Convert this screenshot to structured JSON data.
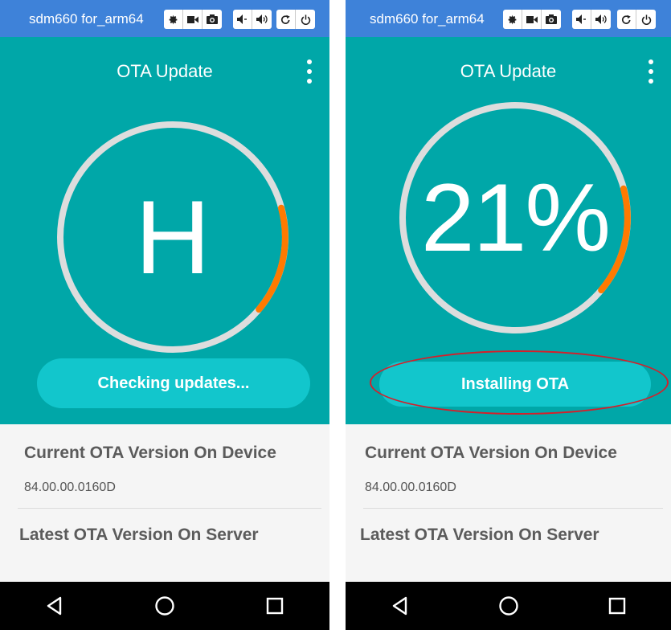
{
  "colors": {
    "window_bar": "#3e82d9",
    "teal": "#00a7a8",
    "button": "#12c6cc",
    "ring_track": "#dddddd",
    "ring_progress": "#ff7a00",
    "highlight": "#d51f2a"
  },
  "left": {
    "window_title": "sdm660 for_arm64",
    "app_title": "OTA Update",
    "ring_text": "H",
    "button_label": "Checking updates...",
    "current_label": "Current OTA Version On Device",
    "current_value": "84.00.00.0160D",
    "latest_label": "Latest OTA Version On Server"
  },
  "right": {
    "window_title": "sdm660 for_arm64",
    "app_title": "OTA Update",
    "ring_text": "21%",
    "button_label": "Installing OTA",
    "current_label": "Current OTA Version On Device",
    "current_value": "84.00.00.0160D",
    "latest_label": "Latest OTA Version On Server"
  },
  "toolbar_icons": [
    "gear-icon",
    "video-icon",
    "camera-icon",
    "volume-down-icon",
    "volume-up-icon",
    "rotate-icon",
    "power-icon"
  ],
  "nav_icons": [
    "back-icon",
    "home-icon",
    "recents-icon"
  ]
}
